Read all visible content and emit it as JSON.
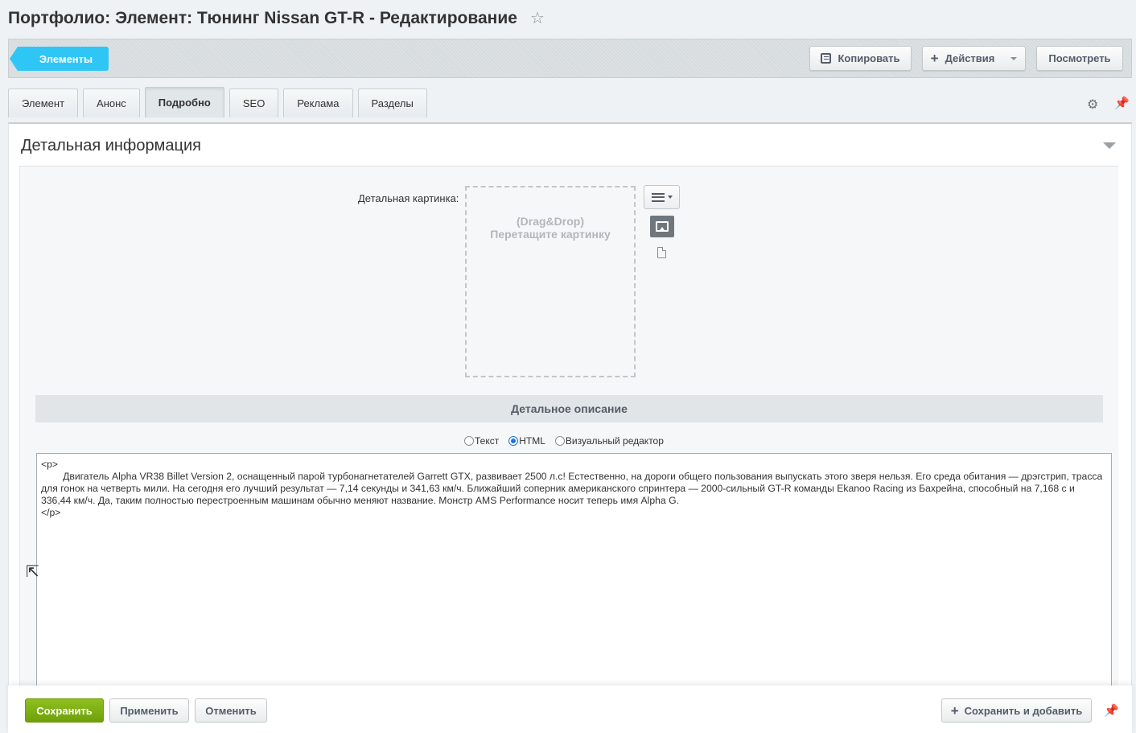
{
  "page": {
    "title": "Портфолио: Элемент: Тюнинг Nissan GT-R - Редактирование",
    "star_icon": "star-icon"
  },
  "toolbar": {
    "back_label": "Элементы",
    "copy_label": "Копировать",
    "actions_label": "Действия",
    "view_label": "Посмотреть"
  },
  "tabs": [
    {
      "label": "Элемент",
      "active": false
    },
    {
      "label": "Анонс",
      "active": false
    },
    {
      "label": "Подробно",
      "active": true
    },
    {
      "label": "SEO",
      "active": false
    },
    {
      "label": "Реклама",
      "active": false
    },
    {
      "label": "Разделы",
      "active": false
    }
  ],
  "section": {
    "title": "Детальная информация",
    "picture_label": "Детальная картинка:",
    "dropzone_line1": "(Drag&Drop)",
    "dropzone_line2": "Перетащите картинку",
    "description_header": "Детальное описание",
    "modes": [
      {
        "label": "Текст",
        "checked": false
      },
      {
        "label": "HTML",
        "checked": true
      },
      {
        "label": "Визуальный редактор",
        "checked": false
      }
    ],
    "editor_content": "<p>\n        Двигатель Alpha VR38 Billet Version 2, оснащенный парой турбонагнетателей Garrett GTX, развивает 2500 л.с! Естественно, на дороги общего пользования выпускать этого зверя нельзя. Его среда обитания — дрэгстрип, трасса для гонок на четверть мили. На сегодня его лучший результат — 7,14 секунды и 341,63 км/ч. Ближайший соперник американского спринтера — 2000-сильный GT-R команды Ekanoo Racing из Бахрейна, способный на 7,168 с и 336,44 км/ч. Да, таким полностью перестроенным машинам обычно меняют название. Монстр AMS Performance носит теперь имя Alpha G.\n</p>"
  },
  "footer": {
    "save_label": "Сохранить",
    "apply_label": "Применить",
    "cancel_label": "Отменить",
    "save_add_label": "Сохранить и добавить"
  },
  "colors": {
    "accent": "#2fc6f6",
    "save_green": "#7cb215"
  }
}
